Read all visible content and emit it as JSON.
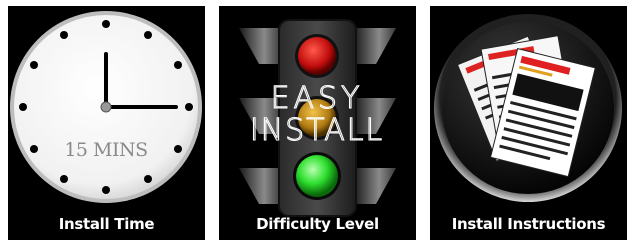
{
  "tiles": [
    {
      "caption": "Install Time",
      "icon": "clock-icon",
      "overlay_text": "15 MINS"
    },
    {
      "caption": "Difficulty Level",
      "icon": "traffic-light-icon",
      "overlay_line1": "EASY",
      "overlay_line2": "INSTALL"
    },
    {
      "caption": "Install Instructions",
      "icon": "documents-icon"
    }
  ],
  "colors": {
    "panel_bg": "#000000",
    "caption_text": "#ffffff",
    "red_light": "#d01010",
    "yellow_light": "#c99a1a",
    "green_light": "#2fe02f"
  }
}
